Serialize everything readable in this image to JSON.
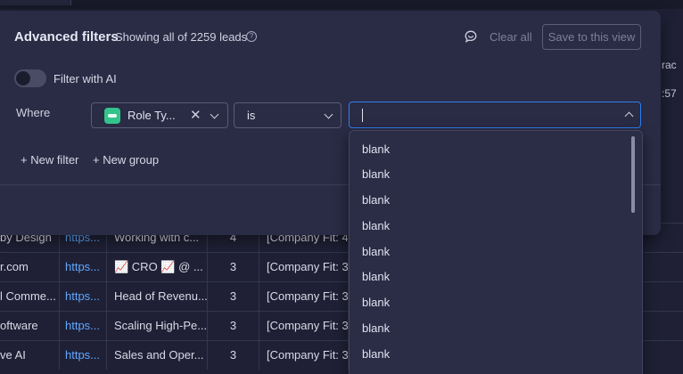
{
  "filters": {
    "title": "Advanced filters",
    "subtitle": "Showing all of 2259 leads",
    "help_icon": "help-circle-icon",
    "feedback_icon": "feedback-chat-icon",
    "clear_all": "Clear all",
    "save_view": "Save to this view",
    "ai_toggle": {
      "label": "Filter with AI",
      "on": false
    },
    "rule": {
      "where_label": "Where",
      "field": "Role Ty...",
      "field_icon": "status-column-icon",
      "field_icon_color": "#33c48b",
      "operator": "is",
      "value": ""
    },
    "new_filter": "+ New filter",
    "new_group": "+ New group"
  },
  "dropdown": {
    "options": [
      "blank",
      "blank",
      "blank",
      "blank",
      "blank",
      "blank",
      "blank",
      "blank",
      "blank"
    ]
  },
  "background": {
    "right_labels": [
      "rac",
      ":57"
    ],
    "rows": [
      [
        "by Design",
        "https...",
        "Working with c...",
        "4",
        "[Company Fit: 4"
      ],
      [
        "r.com",
        "https...",
        "📈 CRO 📈 @ ...",
        "3",
        "[Company Fit: 3"
      ],
      [
        "l Comme...",
        "https...",
        "Head of Revenu...",
        "3",
        "[Company Fit: 3"
      ],
      [
        "oftware",
        "https...",
        "Scaling High-Pe...",
        "3",
        "[Company Fit: 3"
      ],
      [
        "ve AI",
        "https...",
        "Sales and Oper...",
        "3",
        "[Company Fit: 3"
      ]
    ]
  },
  "colors": {
    "accent": "#2f7df0",
    "link": "#5fa8ff",
    "panel": "#2a2b45"
  }
}
